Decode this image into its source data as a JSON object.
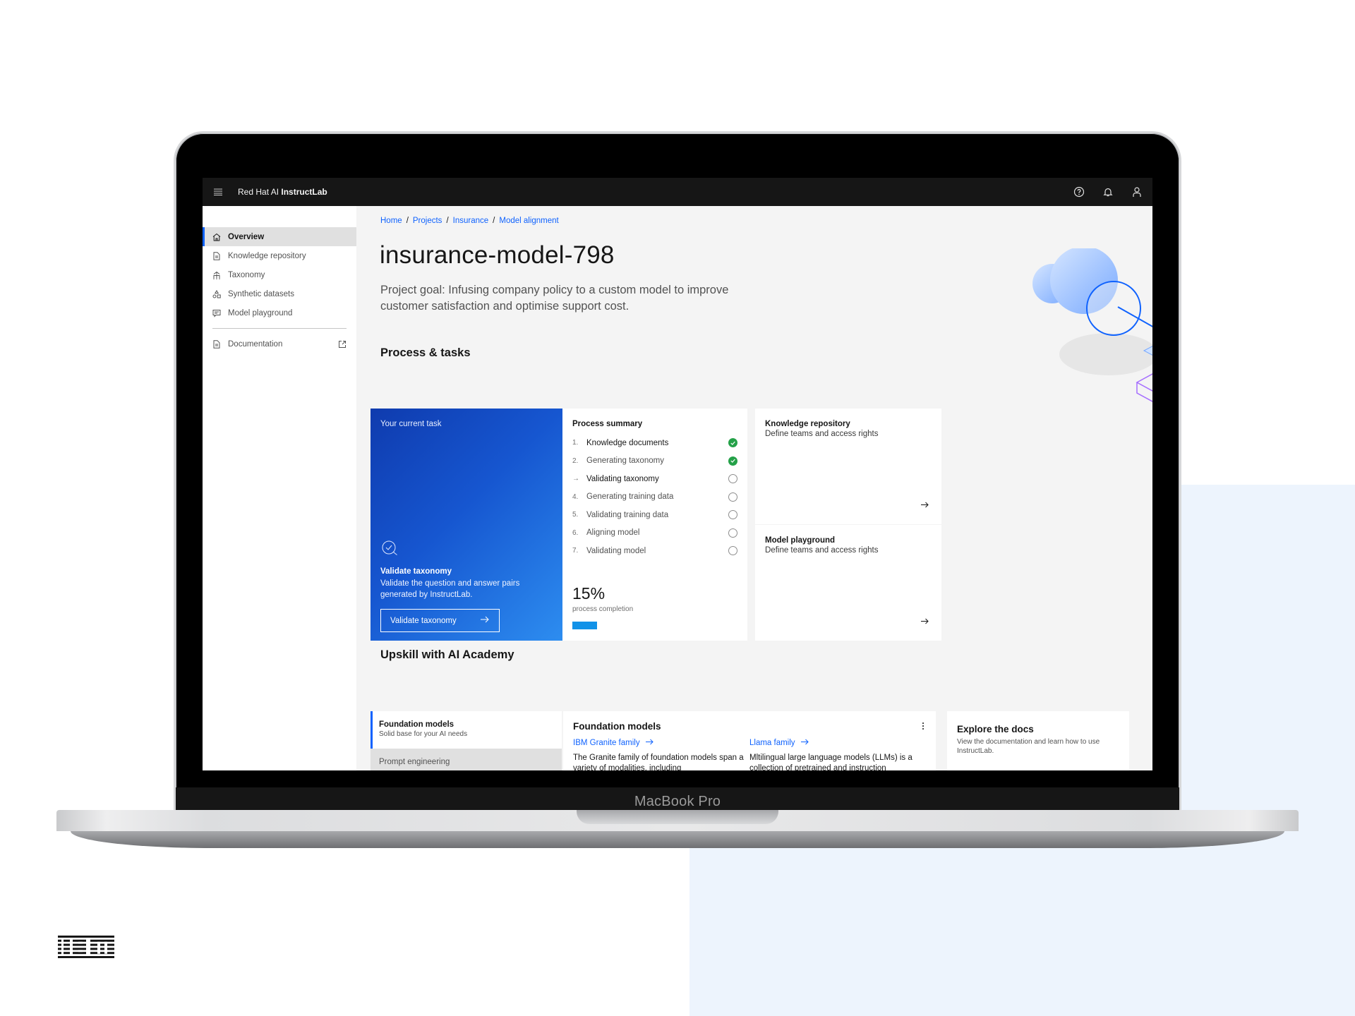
{
  "app": {
    "brand_prefix": "Red Hat AI ",
    "brand_name": "InstructLab"
  },
  "header_icons": [
    "help-icon",
    "notification-icon",
    "user-icon"
  ],
  "sidebar": {
    "items": [
      {
        "label": "Overview",
        "icon": "home-icon",
        "active": true
      },
      {
        "label": "Knowledge repository",
        "icon": "document-icon",
        "active": false
      },
      {
        "label": "Taxonomy",
        "icon": "taxonomy-icon",
        "active": false
      },
      {
        "label": "Synthetic datasets",
        "icon": "datasets-icon",
        "active": false
      },
      {
        "label": "Model playground",
        "icon": "chat-icon",
        "active": false
      }
    ],
    "documentation": {
      "label": "Documentation",
      "icon": "document-icon",
      "external_icon": "launch-icon"
    }
  },
  "breadcrumb": [
    "Home",
    "Projects",
    "Insurance",
    "Model alignment"
  ],
  "page": {
    "title": "insurance-model-798",
    "goal": "Project goal: Infusing company policy to a custom model to improve customer satisfaction and optimise support cost."
  },
  "process": {
    "section_title": "Process & tasks",
    "current_task": {
      "label": "Your current task",
      "title": "Validate taxonomy",
      "description": "Validate the question and answer pairs generated by InstructLab.",
      "button": "Validate taxonomy"
    },
    "summary": {
      "title": "Process summary",
      "steps": [
        {
          "num": "1.",
          "name": "Knowledge documents",
          "status": "done"
        },
        {
          "num": "2.",
          "name": "Generating taxonomy",
          "status": "done"
        },
        {
          "num": "→",
          "name": "Validating taxonomy",
          "status": "current"
        },
        {
          "num": "4.",
          "name": "Generating training data",
          "status": "todo"
        },
        {
          "num": "5.",
          "name": "Validating training data",
          "status": "todo"
        },
        {
          "num": "6.",
          "name": "Aligning model",
          "status": "todo"
        },
        {
          "num": "7.",
          "name": "Validating model",
          "status": "todo"
        }
      ],
      "completion_text": "15%",
      "completion_value": 0.15,
      "completion_label": "process completion"
    },
    "links": [
      {
        "title": "Knowledge repository",
        "description": "Define teams and access rights"
      },
      {
        "title": "Model playground",
        "description": "Define teams and access rights"
      }
    ]
  },
  "academy": {
    "section_title": "Upskill with AI Academy",
    "tabs": [
      {
        "title": "Foundation models",
        "subtitle": "Solid base for your AI needs",
        "active": true
      },
      {
        "title": "Prompt engineering",
        "subtitle": "",
        "active": false
      }
    ],
    "card": {
      "title": "Foundation models",
      "columns": [
        {
          "link": "IBM Granite family",
          "text": "The Granite family of foundation models span a variety of modalities, including"
        },
        {
          "link": "Llama family",
          "text": "Mltilingual large language models (LLMs) is a collection of pretrained and instruction"
        }
      ]
    },
    "docs": {
      "title": "Explore the docs",
      "description": "View the documentation and learn how to use InstructLab."
    }
  },
  "device_label": "MacBook Pro",
  "colors": {
    "accent": "#0f62fe",
    "success": "#24a148",
    "progress": "#1192e8",
    "header": "#161616"
  }
}
